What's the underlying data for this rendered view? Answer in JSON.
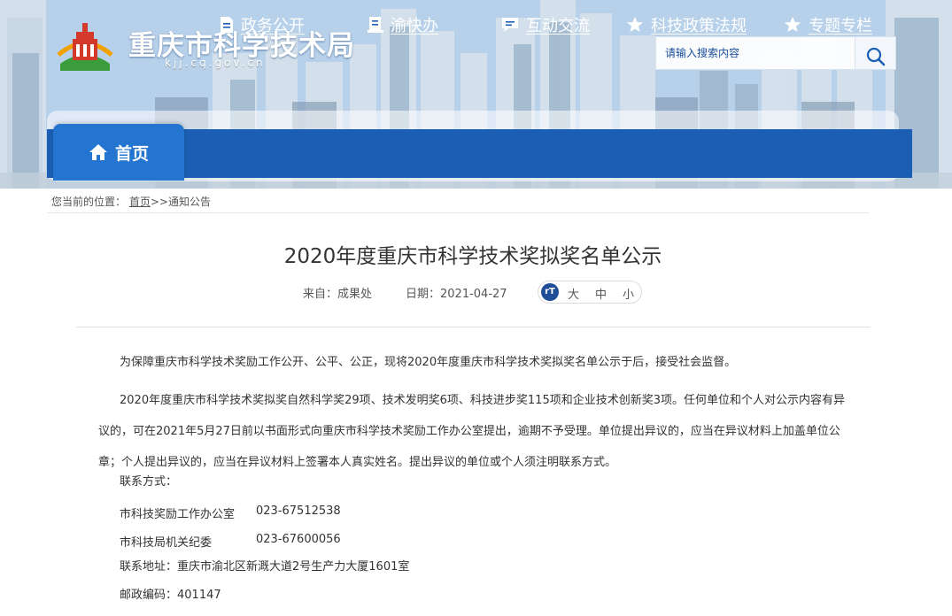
{
  "header": {
    "site_name": "重庆市科学技术局",
    "domain": "kjj.cq.gov.cn",
    "search_placeholder": "请输入搜索内容"
  },
  "nav": {
    "items": [
      {
        "label": "首页",
        "icon": "home-icon"
      },
      {
        "label": "政务公开",
        "icon": "document-icon"
      },
      {
        "label": "渝快办",
        "icon": "book-icon"
      },
      {
        "label": "互动交流",
        "icon": "chat-icon"
      },
      {
        "label": "科技政策法规",
        "icon": "star-icon"
      },
      {
        "label": "专题专栏",
        "icon": "star-icon"
      }
    ]
  },
  "breadcrumb": {
    "prefix": "您当前的位置：",
    "home": "首页",
    "separator": ">>",
    "current": "通知公告"
  },
  "article": {
    "title": "2020年度重庆市科学技术奖拟奖名单公示",
    "source": "来自：成果处",
    "date": "日期：2021-04-27",
    "font_size": {
      "icon_text": "rT",
      "large": "大",
      "medium": "中",
      "small": "小"
    },
    "paragraph_1": "为保障重庆市科学技术奖励工作公开、公平、公正，现将2020年度重庆市科学技术奖拟奖名单公示于后，接受社会监督。",
    "paragraph_2": "2020年度重庆市科学技术奖拟奖自然科学奖29项、技术发明奖6项、科技进步奖115项和企业技术创新奖3项。任何单位和个人对公示内容有异议的，可在2021年5月27日前以书面形式向重庆市科学技术奖励工作办公室提出，逾期不予受理。单位提出异议的，应当在异议材料上加盖单位公章；个人提出异议的，应当在异议材料上签署本人真实姓名。提出异议的单位或个人须注明联系方式。",
    "contact_heading": "联系方式：",
    "contacts": [
      {
        "name": "市科技奖励工作办公室",
        "phone": "023-67512538"
      },
      {
        "name": "市科技局机关纪委",
        "phone": "023-67600056"
      }
    ],
    "address": "联系地址：重庆市渝北区新溉大道2号生产力大厦1601室",
    "postcode": "邮政编码：401147"
  },
  "colors": {
    "nav_bg": "#1a5fb3",
    "nav_active": "#2475cf",
    "text": "#333333"
  }
}
